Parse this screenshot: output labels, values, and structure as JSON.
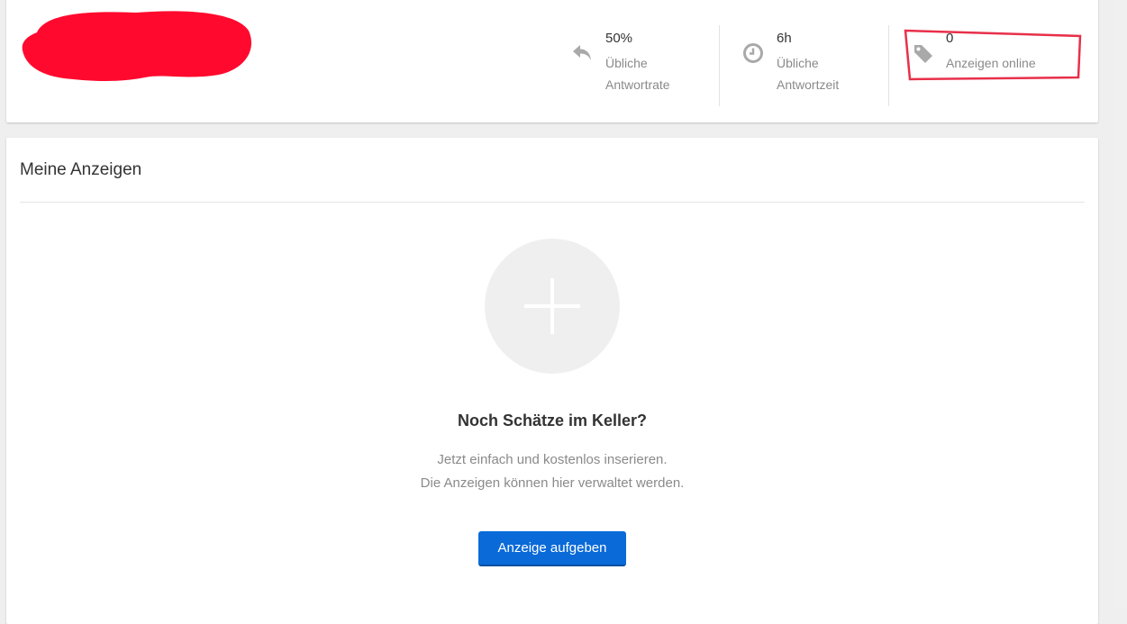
{
  "profile": {
    "stats": [
      {
        "icon": "reply-icon",
        "value": "50%",
        "label_line1": "Übliche",
        "label_line2": "Antwortrate"
      },
      {
        "icon": "clock-icon",
        "value": "6h",
        "label_line1": "Übliche",
        "label_line2": "Antwortzeit"
      },
      {
        "icon": "tag-icon",
        "value": "0",
        "label_line1": "Anzeigen online"
      }
    ]
  },
  "ads": {
    "title": "Meine Anzeigen",
    "empty_heading": "Noch Schätze im Keller?",
    "empty_text_line1": "Jetzt einfach und kostenlos inserieren.",
    "empty_text_line2": "Die Anzeigen können hier verwaltet werden.",
    "add_icon": "plus-icon",
    "cta_label": "Anzeige aufgeben"
  },
  "colors": {
    "accent": "#0a6ad8",
    "redaction": "#ff0a2e",
    "highlight": "#e8304a",
    "icon_gray": "#a9a9a9"
  }
}
